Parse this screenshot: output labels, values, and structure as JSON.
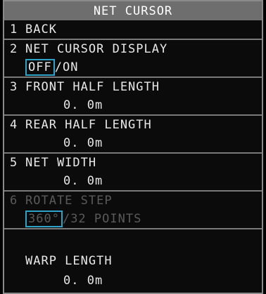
{
  "title": "NET CURSOR",
  "items": [
    {
      "num": "1",
      "label": "BACK"
    },
    {
      "num": "2",
      "label": "NET CURSOR DISPLAY",
      "value_selected": "OFF",
      "value_rest": "/ON"
    },
    {
      "num": "3",
      "label": "FRONT HALF LENGTH",
      "value": "0. 0m"
    },
    {
      "num": "4",
      "label": "REAR HALF LENGTH",
      "value": "0. 0m"
    },
    {
      "num": "5",
      "label": "NET WIDTH",
      "value": "0. 0m"
    },
    {
      "num": "6",
      "label": "ROTATE STEP",
      "value_selected": "360°",
      "value_rest": "/32 POINTS",
      "disabled": true
    },
    {
      "label": "WARP LENGTH",
      "value": "0. 0m"
    }
  ],
  "colors": {
    "background": "#0b0b0b",
    "title_bar": "#6e6e6e",
    "text": "#e8e8e8",
    "disabled_text": "#5a5a5a",
    "selection_border": "#2ea3c7",
    "separator": "#7a7a7a"
  }
}
